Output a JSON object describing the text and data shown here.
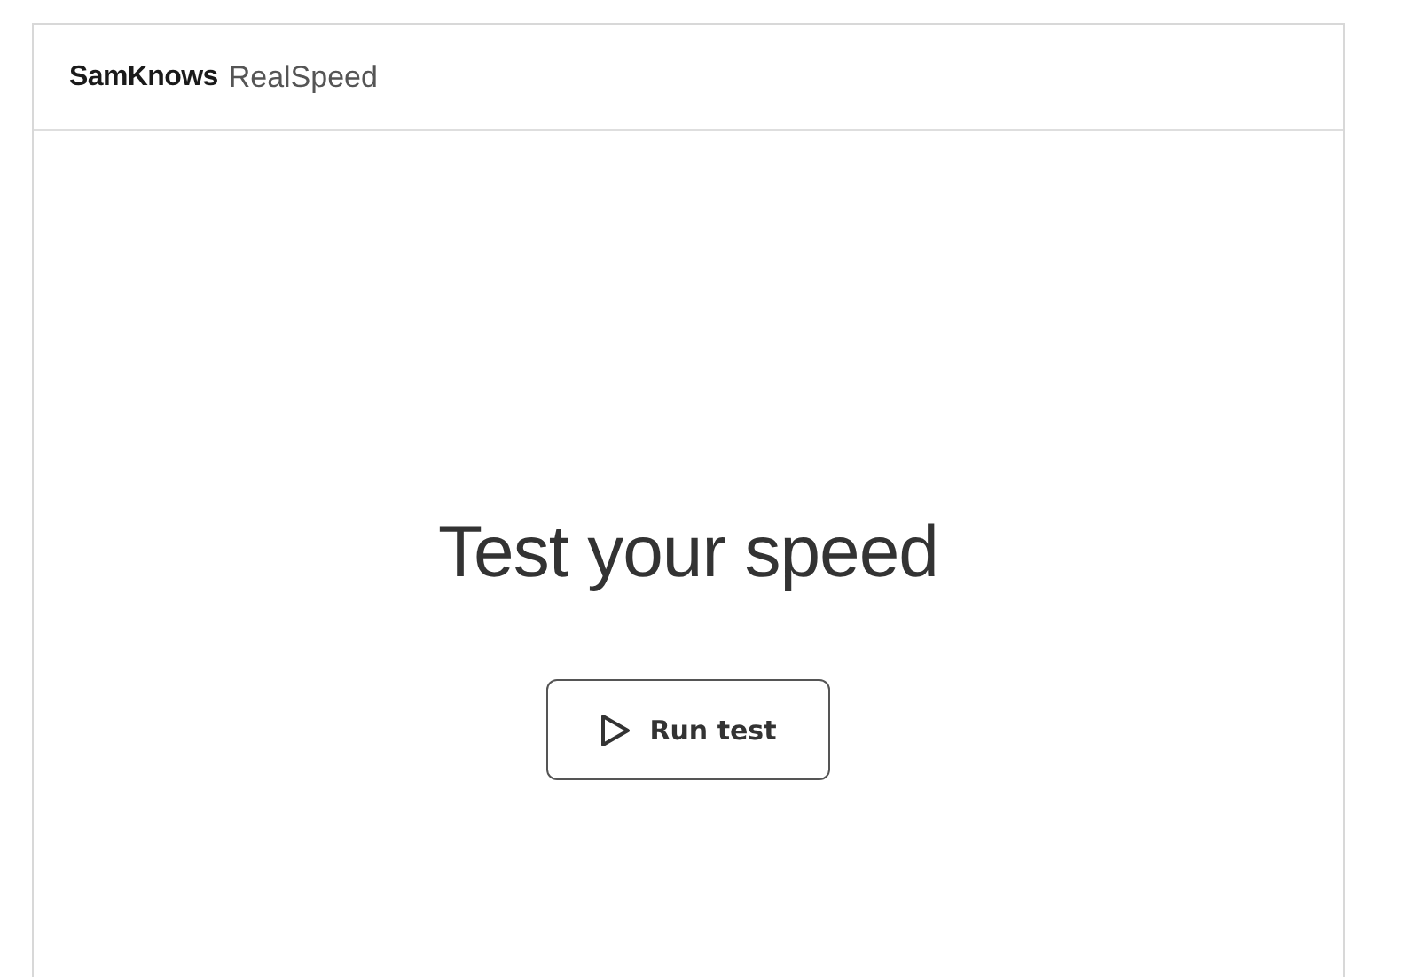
{
  "header": {
    "brand": "SamKnows",
    "product": "RealSpeed"
  },
  "main": {
    "heading": "Test your speed",
    "button": "Run test"
  }
}
